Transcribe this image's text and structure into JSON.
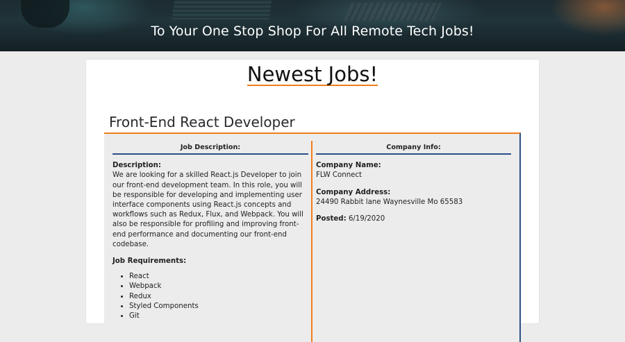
{
  "hero": {
    "title": "To Your One Stop Shop For All Remote Tech Jobs!"
  },
  "page": {
    "title": "Newest Jobs!"
  },
  "job": {
    "title": "Front-End React Developer",
    "description_heading": "Job Description:",
    "description_label": "Description:",
    "description_text": "We are looking for a skilled React.js Developer to join our front-end development team. In this role, you will be responsible for developing and implementing user interface components using React.js concepts and workflows such as Redux, Flux, and Webpack. You will also be responsible for profiling and improving front-end performance and documenting our front-end codebase.",
    "requirements_label": "Job Requirements:",
    "requirements": [
      "React",
      "Webpack",
      "Redux",
      "Styled Components",
      "Git"
    ],
    "company_heading": "Company Info:",
    "company_name_label": "Company Name:",
    "company_name": "FLW Connect",
    "company_address_label": "Company Address:",
    "company_address": "24490 Rabbit lane Waynesville Mo 65583",
    "posted_label": "Posted:",
    "posted": "6/19/2020"
  },
  "colors": {
    "accent_orange": "#ef7d1a",
    "accent_blue": "#2a4f86",
    "page_background": "#ececec"
  }
}
